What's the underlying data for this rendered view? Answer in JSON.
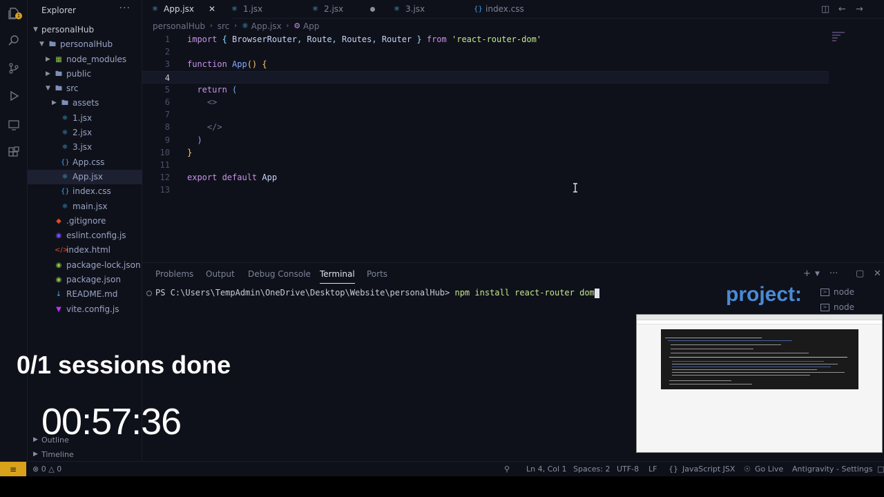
{
  "sidebar": {
    "header": "Explorer",
    "more": "···",
    "tree": [
      {
        "label": "personalHub",
        "depth": 0,
        "type": "root-folder",
        "expanded": true
      },
      {
        "label": "personalHub",
        "depth": 1,
        "type": "folder",
        "expanded": true
      },
      {
        "label": "node_modules",
        "depth": 2,
        "type": "folder-node",
        "expanded": false
      },
      {
        "label": "public",
        "depth": 2,
        "type": "folder",
        "expanded": false
      },
      {
        "label": "src",
        "depth": 2,
        "type": "folder",
        "expanded": true
      },
      {
        "label": "assets",
        "depth": 3,
        "type": "folder",
        "expanded": false
      },
      {
        "label": "1.jsx",
        "depth": 3,
        "type": "react"
      },
      {
        "label": "2.jsx",
        "depth": 3,
        "type": "react"
      },
      {
        "label": "3.jsx",
        "depth": 3,
        "type": "react"
      },
      {
        "label": "App.css",
        "depth": 3,
        "type": "css"
      },
      {
        "label": "App.jsx",
        "depth": 3,
        "type": "react",
        "selected": true
      },
      {
        "label": "index.css",
        "depth": 3,
        "type": "css"
      },
      {
        "label": "main.jsx",
        "depth": 3,
        "type": "react"
      },
      {
        "label": ".gitignore",
        "depth": 2,
        "type": "git"
      },
      {
        "label": "eslint.config.js",
        "depth": 2,
        "type": "eslint"
      },
      {
        "label": "index.html",
        "depth": 2,
        "type": "html"
      },
      {
        "label": "package-lock.json",
        "depth": 2,
        "type": "json"
      },
      {
        "label": "package.json",
        "depth": 2,
        "type": "json"
      },
      {
        "label": "README.md",
        "depth": 2,
        "type": "md"
      },
      {
        "label": "vite.config.js",
        "depth": 2,
        "type": "vite"
      }
    ],
    "outline": "Outline",
    "timeline": "Timeline"
  },
  "tabs": [
    {
      "label": "App.jsx",
      "active": true,
      "type": "react"
    },
    {
      "label": "1.jsx",
      "type": "react"
    },
    {
      "label": "2.jsx",
      "type": "react",
      "dirty": true
    },
    {
      "label": "3.jsx",
      "type": "react"
    },
    {
      "label": "index.css",
      "type": "css"
    }
  ],
  "breadcrumb": [
    "personalHub",
    "src",
    "App.jsx",
    "App"
  ],
  "editor": {
    "current_line": 4,
    "lines": [
      [
        [
          "kw",
          "import"
        ],
        [
          "pn",
          " { "
        ],
        [
          "id",
          "BrowserRouter"
        ],
        [
          "pn",
          ", "
        ],
        [
          "id",
          "Route"
        ],
        [
          "pn",
          ", "
        ],
        [
          "id",
          "Routes"
        ],
        [
          "pn",
          ", "
        ],
        [
          "id",
          "Router"
        ],
        [
          "pn",
          " } "
        ],
        [
          "kw",
          "from"
        ],
        [
          "str",
          " 'react-router-dom'"
        ]
      ],
      [],
      [
        [
          "kw",
          "function"
        ],
        [
          "fn",
          " App"
        ],
        [
          "br",
          "()"
        ],
        [
          "pn",
          " "
        ],
        [
          "br",
          "{"
        ]
      ],
      [],
      [
        [
          "pn",
          "  "
        ],
        [
          "kw",
          "return"
        ],
        [
          "pn",
          " "
        ],
        [
          "fn",
          "("
        ]
      ],
      [
        [
          "tg",
          "    <>"
        ]
      ],
      [],
      [
        [
          "tg",
          "    </>"
        ]
      ],
      [
        [
          "pn",
          "  "
        ],
        [
          "fn",
          ")"
        ]
      ],
      [
        [
          "br",
          "}"
        ]
      ],
      [],
      [
        [
          "kw",
          "export"
        ],
        [
          "kw",
          " default"
        ],
        [
          "id",
          " App"
        ]
      ],
      []
    ]
  },
  "panel": {
    "tabs": [
      "Problems",
      "Output",
      "Debug Console",
      "Terminal",
      "Ports"
    ],
    "active_tab": "Terminal",
    "prompt": "PS C:\\Users\\TempAdmin\\OneDrive\\Desktop\\Website\\personalHub> ",
    "command": "npm install react-router dom",
    "terminals": [
      "node",
      "node"
    ]
  },
  "overlay": {
    "sessions": "0/1 sessions done",
    "timer": "00:57:36",
    "project": "project:"
  },
  "status": {
    "errors": "0",
    "warnings": "0",
    "position": "Ln 4, Col 1",
    "spaces": "Spaces: 2",
    "encoding": "UTF-8",
    "eol": "LF",
    "language": "JavaScript JSX",
    "golive": "Go Live",
    "extension": "Antigravity - Settings"
  },
  "colors": {
    "background": "#0f111a",
    "accent": "#d9a21b",
    "react": "#4fc3f7",
    "keyword": "#c792ea",
    "string": "#c3e88d"
  }
}
